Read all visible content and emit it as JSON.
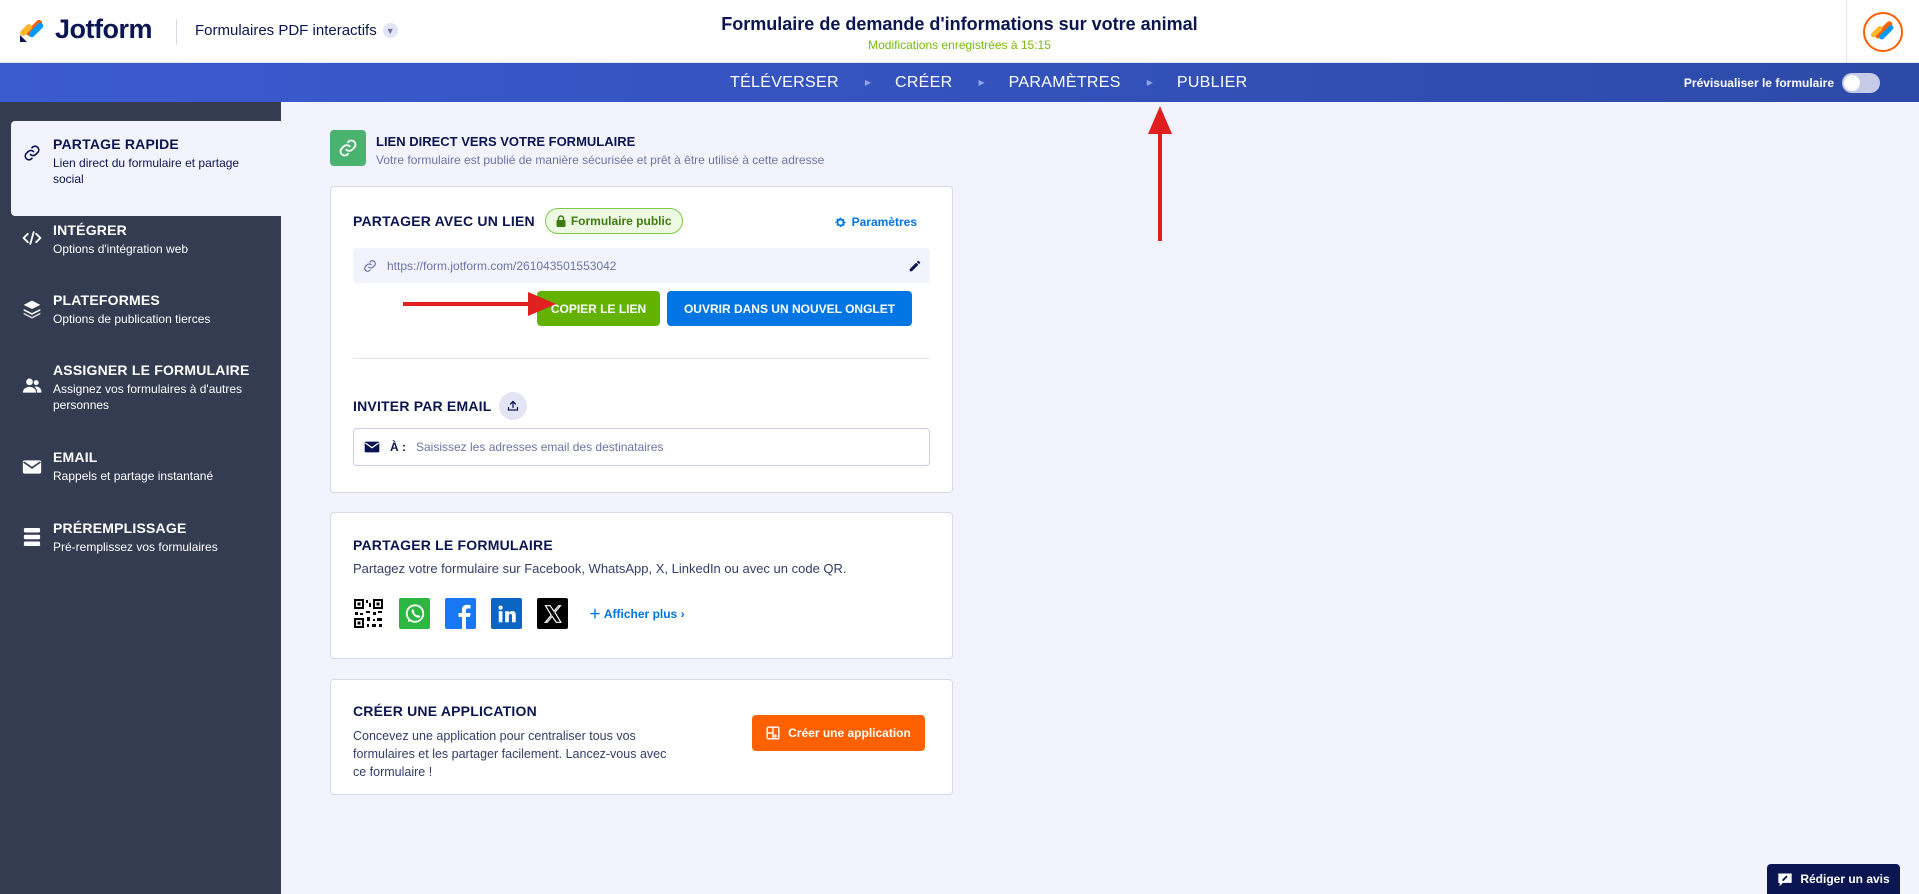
{
  "header": {
    "brand": "Jotform",
    "product": "Formulaires PDF interactifs",
    "form_title": "Formulaire de demande d'informations sur votre animal",
    "saved_status": "Modifications enregistrées à 15:15"
  },
  "nav": {
    "items": [
      "TÉLÉVERSER",
      "CRÉER",
      "PARAMÈTRES",
      "PUBLIER"
    ],
    "preview_label": "Prévisualiser le formulaire"
  },
  "sidebar": {
    "items": [
      {
        "title": "PARTAGE RAPIDE",
        "desc": "Lien direct du formulaire et partage social"
      },
      {
        "title": "INTÉGRER",
        "desc": "Options d'intégration web"
      },
      {
        "title": "PLATEFORMES",
        "desc": "Options de publication tierces"
      },
      {
        "title": "ASSIGNER LE FORMULAIRE",
        "desc": "Assignez vos formulaires à d'autres personnes"
      },
      {
        "title": "EMAIL",
        "desc": "Rappels et partage instantané"
      },
      {
        "title": "PRÉREMPLISSAGE",
        "desc": "Pré-remplissez vos formulaires"
      }
    ]
  },
  "direct_link": {
    "title": "LIEN DIRECT VERS VOTRE FORMULAIRE",
    "subtitle": "Votre formulaire est publié de manière sécurisée et prêt à être utilisé à cette adresse"
  },
  "share_link": {
    "title": "PARTAGER AVEC UN LIEN",
    "badge": "Formulaire public",
    "settings": "Paramètres",
    "url": "https://form.jotform.com/261043501553042",
    "copy_button": "COPIER LE LIEN",
    "open_button": "OUVRIR DANS UN NOUVEL ONGLET"
  },
  "invite": {
    "title": "INVITER PAR EMAIL",
    "to_label": "À :",
    "placeholder": "Saisissez les adresses email des destinataires"
  },
  "share_form": {
    "title": "PARTAGER LE FORMULAIRE",
    "desc": "Partagez votre formulaire sur Facebook, WhatsApp, X, LinkedIn ou avec un code QR.",
    "more": "Afficher plus"
  },
  "create_app": {
    "title": "CRÉER UNE APPLICATION",
    "desc": "Concevez une application pour centraliser tous vos formulaires et les partager facilement. Lancez-vous avec ce formulaire !",
    "button": "Créer une application"
  },
  "review_button": "Rédiger un avis",
  "colors": {
    "primary_navy": "#0a1551",
    "sidebar_bg": "#343c52",
    "nav_blue": "#3b5bd1",
    "copy_green": "#64b200",
    "open_blue": "#0075e3",
    "app_orange": "#ff6100",
    "annotation_red": "#e01f1f"
  }
}
